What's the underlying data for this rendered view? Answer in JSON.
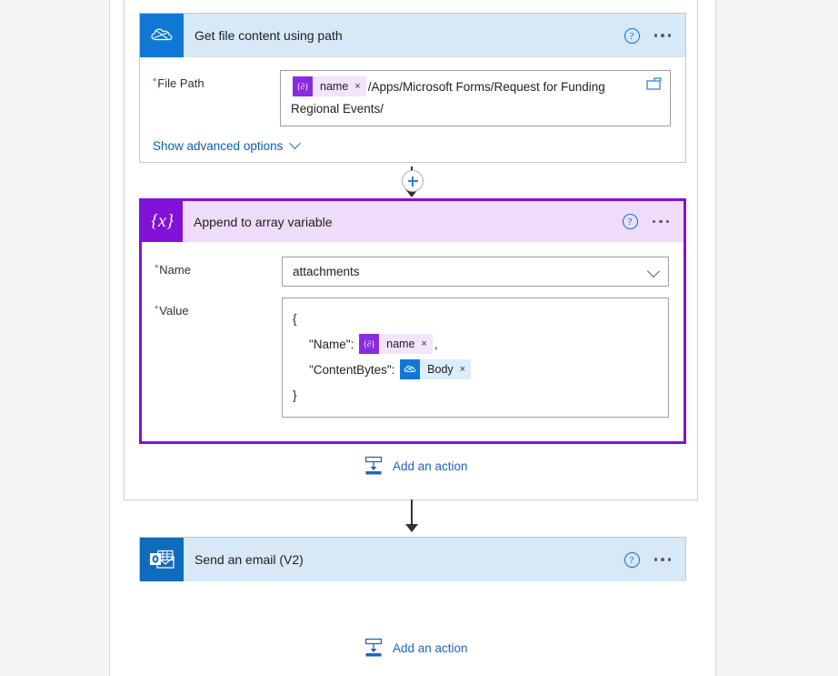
{
  "flow": {
    "scope_container": {
      "name": "apply-to-each-scope"
    },
    "actions": [
      {
        "id": "get-file-content-using-path",
        "title": "Get file content using path",
        "connector_icon": "onedrive-icon",
        "help_tooltip": "?",
        "menu_tooltip": "...",
        "fields": [
          {
            "label": "File Path",
            "required": true,
            "tokens": [
              {
                "icon": "expression-icon",
                "label": "name",
                "remove": "×"
              }
            ],
            "text_after_token": "/Apps/Microsoft Forms/Request for Funding Regional Events/",
            "browse_icon": "folder-icon"
          }
        ],
        "advanced_options_label": "Show advanced options"
      },
      {
        "id": "append-to-array-variable",
        "title": "Append to array variable",
        "connector_icon": "variable-braces-icon",
        "icon_glyph": "{x}",
        "selected": true,
        "help_tooltip": "?",
        "menu_tooltip": "...",
        "name_field": {
          "label": "Name",
          "required": true,
          "value": "attachments",
          "dropdown_icon": "chevron-down-icon"
        },
        "value_field": {
          "label": "Value",
          "required": true,
          "lines": [
            {
              "text": "{",
              "indent": false,
              "token": null
            },
            {
              "text": "\"Name\":",
              "indent": true,
              "token": {
                "icon": "expression-icon",
                "label": "name",
                "remove": "×"
              },
              "suffix": ","
            },
            {
              "text": "\"ContentBytes\":",
              "indent": true,
              "token": {
                "icon": "onedrive-icon",
                "label": "Body",
                "remove": "×"
              },
              "suffix": ""
            },
            {
              "text": "}",
              "indent": false,
              "token": null
            }
          ]
        }
      },
      {
        "id": "send-an-email-v2",
        "title": "Send an email (V2)",
        "connector_icon": "outlook-icon",
        "help_tooltip": "?",
        "menu_tooltip": "..."
      }
    ],
    "add_action_buttons": [
      {
        "id": "add-action-inside-scope",
        "label": "Add an action",
        "icon": "insert-action-icon"
      },
      {
        "id": "add-action-bottom",
        "label": "Add an action",
        "icon": "insert-action-icon"
      }
    ],
    "connectors": [
      {
        "id": "insert-between-getfile-and-append",
        "type": "plus-node",
        "glyph": "+"
      }
    ],
    "colors": {
      "onedrive_blue": "#0f78d4",
      "outlook_blue": "#0f6cbd",
      "variable_purple": "#8211d8",
      "card_header_blue": "#d7e8f7",
      "card_header_purple": "#eedcfa",
      "link_blue": "#1f63c4",
      "required_red": "#d13438",
      "canvas_gray": "#f5f5f5"
    }
  }
}
